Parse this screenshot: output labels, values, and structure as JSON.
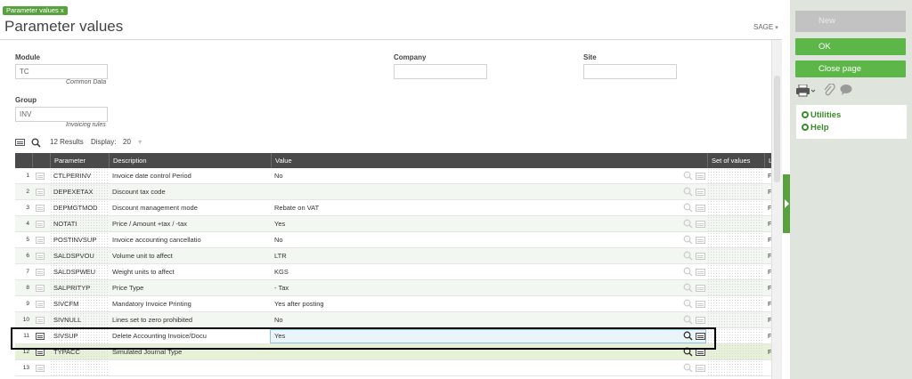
{
  "tab": {
    "label": "Parameter values x"
  },
  "page": {
    "title": "Parameter values",
    "sage_menu": "SAGE"
  },
  "fields": {
    "module": {
      "label": "Module",
      "value": "TC",
      "description": "Common Data"
    },
    "company": {
      "label": "Company",
      "value": ""
    },
    "site": {
      "label": "Site",
      "value": ""
    },
    "group": {
      "label": "Group",
      "value": "INV",
      "description": "Invoicing rules"
    }
  },
  "table_toolbar": {
    "results": "12 Results",
    "display_label": "Display:",
    "display_value": "20"
  },
  "table": {
    "columns": [
      "",
      "Parameter",
      "Description",
      "Value",
      "Set of values",
      "L"
    ],
    "rows": [
      {
        "num": "1",
        "parameter": "CTLPERINV",
        "description": "Invoice date control Period",
        "value": "No",
        "last": "F"
      },
      {
        "num": "2",
        "parameter": "DEPEXETAX",
        "description": "Discount tax code",
        "value": "",
        "last": "F"
      },
      {
        "num": "3",
        "parameter": "DEPMGTMOD",
        "description": "Discount management mode",
        "value": "Rebate on VAT",
        "last": "F"
      },
      {
        "num": "4",
        "parameter": "NOTATI",
        "description": "Price / Amount +tax / -tax",
        "value": "Yes",
        "last": "F"
      },
      {
        "num": "5",
        "parameter": "POSTINVSUP",
        "description": "Invoice accounting cancellatio",
        "value": "No",
        "last": "F"
      },
      {
        "num": "6",
        "parameter": "SALDSPVOU",
        "description": "Volume unit to affect",
        "value": "LTR",
        "last": "F"
      },
      {
        "num": "7",
        "parameter": "SALDSPWEU",
        "description": "Weight units to affect",
        "value": "KGS",
        "last": "F"
      },
      {
        "num": "8",
        "parameter": "SALPRITYP",
        "description": "Price Type",
        "value": "- Tax",
        "last": "F"
      },
      {
        "num": "9",
        "parameter": "SIVCFM",
        "description": "Mandatory Invoice Printing",
        "value": "Yes after posting",
        "last": "F"
      },
      {
        "num": "10",
        "parameter": "SIVNULL",
        "description": "Lines set to zero prohibited",
        "value": "No",
        "last": "F"
      },
      {
        "num": "11",
        "parameter": "SIVSUP",
        "description": "Delete Accounting Invoice/Docu",
        "value": "Yes",
        "last": "F"
      },
      {
        "num": "12",
        "parameter": "TYPACC",
        "description": "Simulated Journal Type",
        "value": "",
        "last": "F"
      },
      {
        "num": "13",
        "parameter": "",
        "description": "",
        "value": "",
        "last": ""
      }
    ]
  },
  "right_panel": {
    "new_label": "New",
    "ok_label": "OK",
    "close_label": "Close page",
    "utilities_label": "Utilities",
    "help_label": "Help"
  },
  "colors": {
    "accent": "#5cb648",
    "header": "#4a4a4a",
    "panel": "#dfe5dc"
  }
}
